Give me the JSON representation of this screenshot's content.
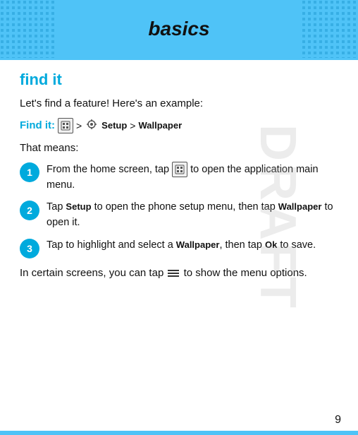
{
  "header": {
    "title": "basics"
  },
  "page": {
    "number": "9"
  },
  "section": {
    "title": "find it",
    "intro": "Let's find a feature! Here's an example:",
    "find_it_label": "Find it:",
    "find_it_path": "> Setup > Wallpaper",
    "that_means": "That means:",
    "steps": [
      {
        "num": "1",
        "text": "From the home screen, tap  to open the application main menu."
      },
      {
        "num": "2",
        "text": "Tap Setup to open the phone setup menu, then tap Wallpaper to open it."
      },
      {
        "num": "3",
        "text": "Tap to highlight and select a Wallpaper, then tap Ok to save."
      }
    ],
    "footer_text": "In certain screens, you can tap   to show the menu options."
  },
  "draft_watermark": "DRAFT"
}
